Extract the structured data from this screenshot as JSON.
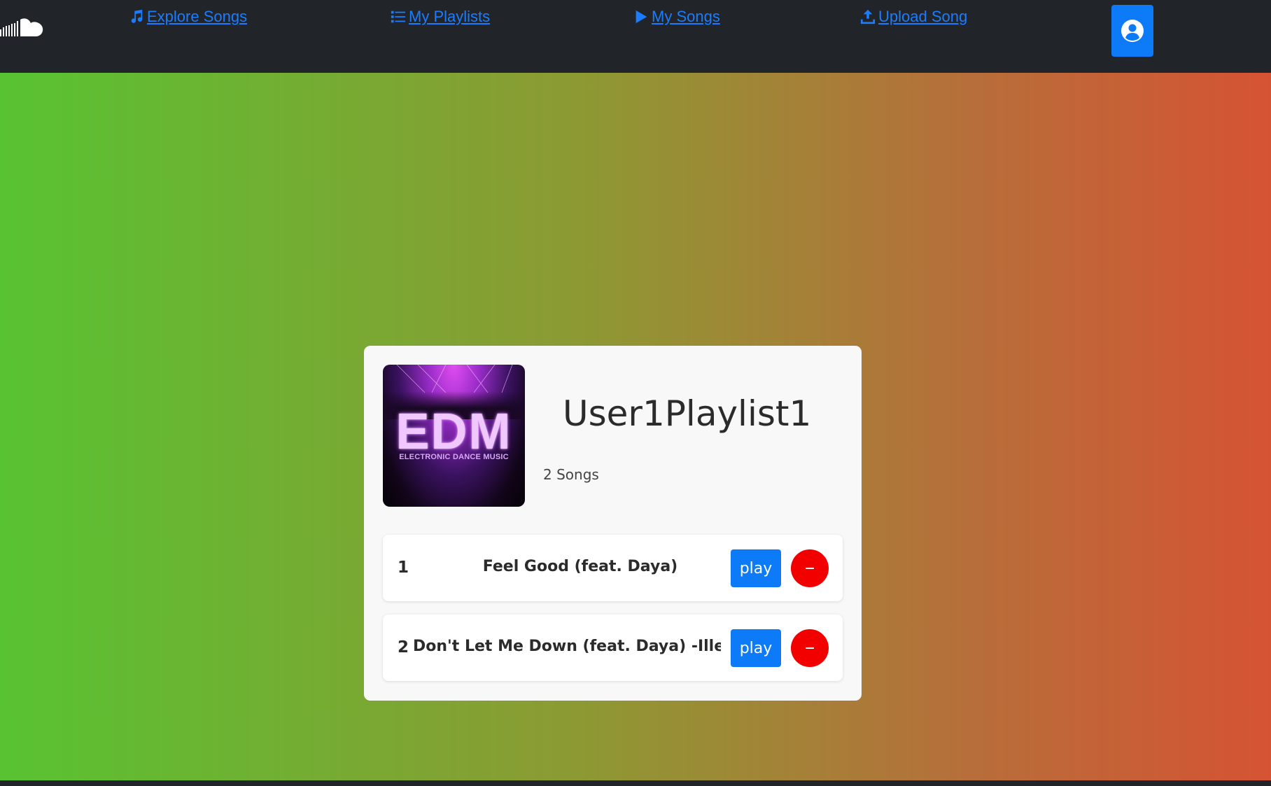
{
  "nav": {
    "explore_label": "Explore Songs",
    "playlists_label": "My Playlists",
    "mysongs_label": "My Songs",
    "upload_label": "Upload Song",
    "link_color": "#1a7cff",
    "icons": {
      "logo": "soundcloud-cloud-icon",
      "explore": "music-note-icon",
      "playlists": "list-icon",
      "mysongs": "play-icon",
      "upload": "upload-icon",
      "profile": "user-circle-icon"
    }
  },
  "playlist": {
    "cover": {
      "main_text": "EDM",
      "sub_text": "ELECTRONIC DANCE MUSIC"
    },
    "title": "User1Playlist1",
    "song_count_text": "2 Songs",
    "songs": [
      {
        "number": "1",
        "title": "Feel Good (feat. Daya)",
        "play_label": "play",
        "remove_label": "–"
      },
      {
        "number": "2",
        "title": "Don't Let Me Down (feat. Daya) -Illenium",
        "play_label": "play",
        "remove_label": "–"
      }
    ]
  },
  "colors": {
    "navbar_bg": "#212529",
    "primary": "#0d7bf7",
    "danger": "#f20000",
    "gradient_start": "#58c332",
    "gradient_end": "#d55333"
  }
}
